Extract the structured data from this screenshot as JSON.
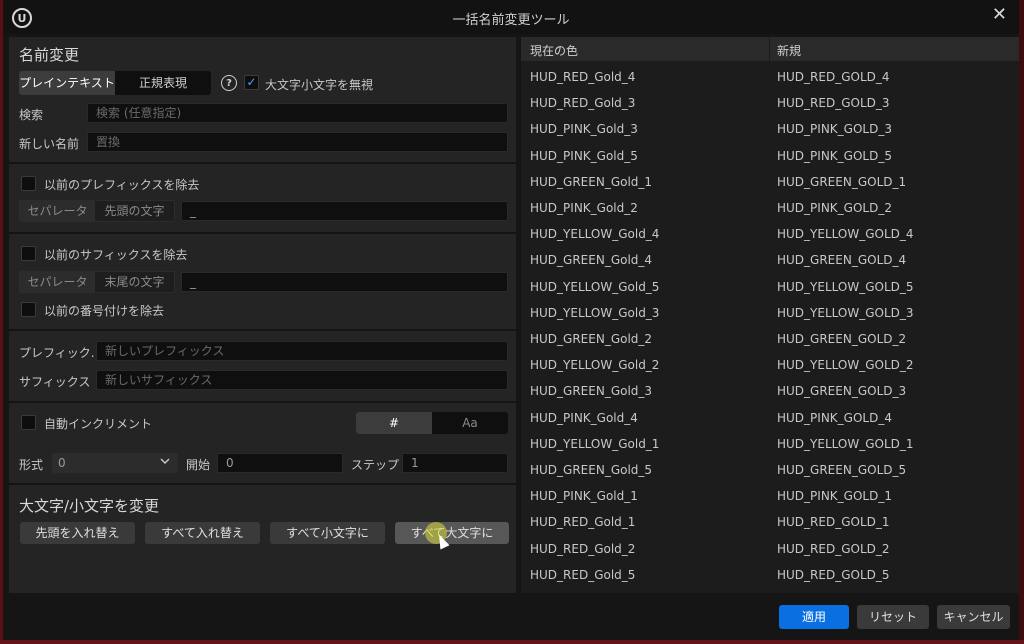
{
  "window": {
    "title": "一括名前変更ツール",
    "logo_text": "U",
    "close_glyph": "✕"
  },
  "rename": {
    "section_title": "名前変更",
    "mode_tabs": [
      "プレインテキスト",
      "正規表現"
    ],
    "mode_selected": "プレインテキスト",
    "help_glyph": "?",
    "ignore_case_label": "大文字小文字を無視",
    "ignore_case_checked": true,
    "search_label": "検索",
    "search_placeholder": "検索 (任意指定)",
    "new_name_label": "新しい名前",
    "new_name_placeholder": "置換"
  },
  "remove_prefix": {
    "label": "以前のプレフィックスを除去",
    "checked": false,
    "separator_label": "セパレータ",
    "mode_label": "先頭の文字",
    "separator_value": "_"
  },
  "remove_suffix": {
    "label": "以前のサフィックスを除去",
    "checked": false,
    "separator_label": "セパレータ",
    "mode_label": "末尾の文字",
    "separator_value": "_"
  },
  "remove_numbering": {
    "label": "以前の番号付けを除去",
    "checked": false
  },
  "affix": {
    "prefix_label": "プレフィック.",
    "prefix_placeholder": "新しいプレフィックス",
    "suffix_label": "サフィックス",
    "suffix_placeholder": "新しいサフィックス"
  },
  "auto_increment": {
    "label": "自動インクリメント",
    "checked": false,
    "toggle": [
      "#",
      "Aa"
    ],
    "toggle_selected": "#",
    "format_label": "形式",
    "format_value": "0",
    "start_label": "開始",
    "start_value": "0",
    "step_label": "ステップ",
    "step_value": "1"
  },
  "case_change": {
    "section_title": "大文字/小文字を変更",
    "buttons": [
      "先頭を入れ替え",
      "すべて入れ替え",
      "すべて小文字に",
      "すべて大文字に"
    ],
    "hovered": "すべて大文字に"
  },
  "table": {
    "headers": [
      "現在の色",
      "新規"
    ],
    "rows": [
      [
        "HUD_RED_Gold_4",
        "HUD_RED_GOLD_4"
      ],
      [
        "HUD_RED_Gold_3",
        "HUD_RED_GOLD_3"
      ],
      [
        "HUD_PINK_Gold_3",
        "HUD_PINK_GOLD_3"
      ],
      [
        "HUD_PINK_Gold_5",
        "HUD_PINK_GOLD_5"
      ],
      [
        "HUD_GREEN_Gold_1",
        "HUD_GREEN_GOLD_1"
      ],
      [
        "HUD_PINK_Gold_2",
        "HUD_PINK_GOLD_2"
      ],
      [
        "HUD_YELLOW_Gold_4",
        "HUD_YELLOW_GOLD_4"
      ],
      [
        "HUD_GREEN_Gold_4",
        "HUD_GREEN_GOLD_4"
      ],
      [
        "HUD_YELLOW_Gold_5",
        "HUD_YELLOW_GOLD_5"
      ],
      [
        "HUD_YELLOW_Gold_3",
        "HUD_YELLOW_GOLD_3"
      ],
      [
        "HUD_GREEN_Gold_2",
        "HUD_GREEN_GOLD_2"
      ],
      [
        "HUD_YELLOW_Gold_2",
        "HUD_YELLOW_GOLD_2"
      ],
      [
        "HUD_GREEN_Gold_3",
        "HUD_GREEN_GOLD_3"
      ],
      [
        "HUD_PINK_Gold_4",
        "HUD_PINK_GOLD_4"
      ],
      [
        "HUD_YELLOW_Gold_1",
        "HUD_YELLOW_GOLD_1"
      ],
      [
        "HUD_GREEN_Gold_5",
        "HUD_GREEN_GOLD_5"
      ],
      [
        "HUD_PINK_Gold_1",
        "HUD_PINK_GOLD_1"
      ],
      [
        "HUD_RED_Gold_1",
        "HUD_RED_GOLD_1"
      ],
      [
        "HUD_RED_Gold_2",
        "HUD_RED_GOLD_2"
      ],
      [
        "HUD_RED_Gold_5",
        "HUD_RED_GOLD_5"
      ]
    ]
  },
  "footer": {
    "apply_label": "適用",
    "reset_label": "リセット",
    "cancel_label": "キャンセル"
  },
  "colors": {
    "accent": "#0a6fe0",
    "check": "#4aa3ff"
  },
  "icons": {
    "dropdown": "chevron-down-icon",
    "help": "help-circle-icon",
    "check": "checkmark-icon"
  }
}
